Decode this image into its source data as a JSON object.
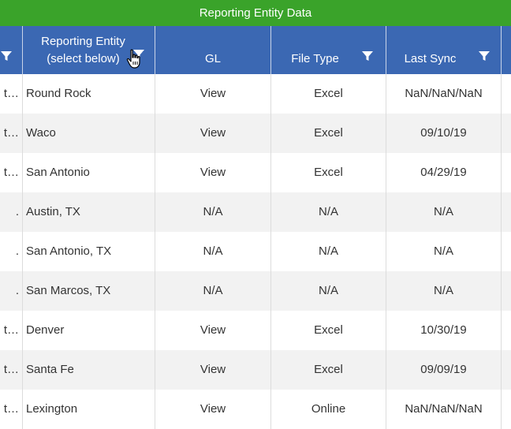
{
  "banner": {
    "title": "Reporting Entity Data"
  },
  "header": {
    "entity_line1": "Reporting Entity",
    "entity_line2": "(select below)",
    "gl": "GL",
    "file_type": "File Type",
    "last_sync": "Last Sync"
  },
  "colors": {
    "banner": "#3aa32a",
    "header": "#3b68b3",
    "alt_row": "#f2f2f2"
  },
  "rows": [
    {
      "prefix": "t…",
      "entity": "Round Rock",
      "gl": "View",
      "file_type": "Excel",
      "last_sync": "NaN/NaN/NaN"
    },
    {
      "prefix": "t…",
      "entity": "Waco",
      "gl": "View",
      "file_type": "Excel",
      "last_sync": "09/10/19"
    },
    {
      "prefix": "t…",
      "entity": "San Antonio",
      "gl": "View",
      "file_type": "Excel",
      "last_sync": "04/29/19"
    },
    {
      "prefix": ".",
      "entity": "Austin, TX",
      "gl": "N/A",
      "file_type": "N/A",
      "last_sync": "N/A"
    },
    {
      "prefix": ".",
      "entity": "San Antonio, TX",
      "gl": "N/A",
      "file_type": "N/A",
      "last_sync": "N/A"
    },
    {
      "prefix": ".",
      "entity": "San Marcos, TX",
      "gl": "N/A",
      "file_type": "N/A",
      "last_sync": "N/A"
    },
    {
      "prefix": "t…",
      "entity": "Denver",
      "gl": "View",
      "file_type": "Excel",
      "last_sync": "10/30/19"
    },
    {
      "prefix": "t…",
      "entity": "Santa Fe",
      "gl": "View",
      "file_type": "Excel",
      "last_sync": "09/09/19"
    },
    {
      "prefix": "t…",
      "entity": "Lexington",
      "gl": "View",
      "file_type": "Online",
      "last_sync": "NaN/NaN/NaN"
    }
  ]
}
